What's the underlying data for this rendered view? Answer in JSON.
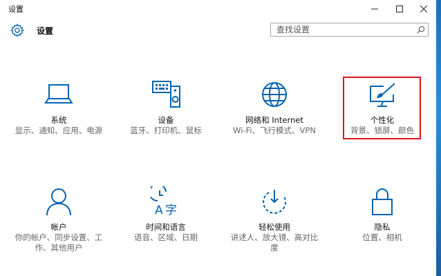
{
  "window": {
    "title": "设置",
    "controls": {
      "minimize": "minimize-icon",
      "maximize": "maximize-icon",
      "close": "close-icon"
    }
  },
  "header": {
    "title": "设置",
    "icon": "gear-icon",
    "search": {
      "placeholder": "查找设置",
      "icon": "search-icon"
    }
  },
  "tiles": [
    {
      "id": "system",
      "icon": "laptop-icon",
      "name": "系统",
      "desc": "显示、通知、应用、电源"
    },
    {
      "id": "devices",
      "icon": "keyboard-speaker-icon",
      "name": "设备",
      "desc": "蓝牙、打印机、鼠标"
    },
    {
      "id": "network",
      "icon": "globe-icon",
      "name": "网络和 Internet",
      "desc": "Wi-Fi、飞行模式、VPN"
    },
    {
      "id": "personalization",
      "icon": "paint-brush-icon",
      "name": "个性化",
      "desc": "背景、锁屏、颜色",
      "highlighted": true
    },
    {
      "id": "accounts",
      "icon": "person-icon",
      "name": "帐户",
      "desc": "你的帐户、同步设置、工作、其他用户"
    },
    {
      "id": "time-language",
      "icon": "time-language-icon",
      "name": "时间和语言",
      "desc": "语音、区域、日期"
    },
    {
      "id": "ease-of-access",
      "icon": "ease-of-access-icon",
      "name": "轻松使用",
      "desc": "讲述人、放大镜、高对比度"
    },
    {
      "id": "privacy",
      "icon": "lock-icon",
      "name": "隐私",
      "desc": "位置、相机"
    }
  ],
  "colors": {
    "accent": "#0063b1",
    "highlight": "#e0121a"
  }
}
